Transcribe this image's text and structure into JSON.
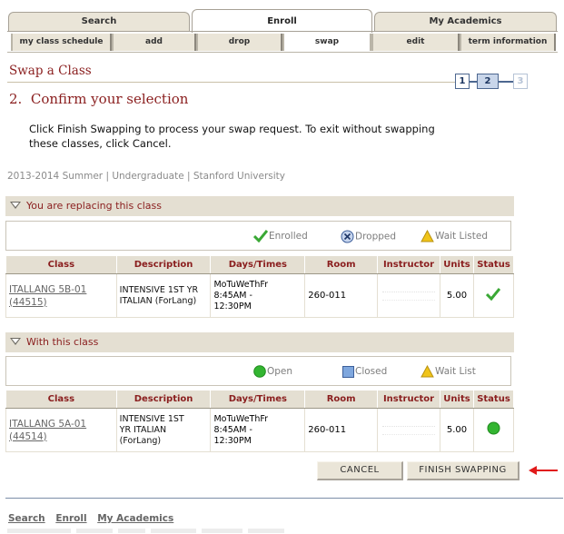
{
  "main_tabs": [
    {
      "label": "Search",
      "active": false
    },
    {
      "label": "Enroll",
      "active": true
    },
    {
      "label": "My Academics",
      "active": false
    }
  ],
  "sub_tabs": [
    {
      "label": "my class schedule",
      "active": false
    },
    {
      "label": "add",
      "active": false
    },
    {
      "label": "drop",
      "active": false
    },
    {
      "label": "swap",
      "active": true
    },
    {
      "label": "edit",
      "active": false
    },
    {
      "label": "term information",
      "active": false
    }
  ],
  "page": {
    "title": "Swap a Class",
    "step_title": "2.  Confirm your selection",
    "instructions": "Click Finish Swapping to process your swap request. To exit without swapping these classes, click Cancel.",
    "term_line": "2013-2014 Summer | Undergraduate | Stanford University"
  },
  "steps": {
    "items": [
      "1",
      "2",
      "3"
    ],
    "current": 2
  },
  "replacing": {
    "header": "You are replacing this class",
    "legend": [
      {
        "icon": "checkmark-icon",
        "label": "Enrolled"
      },
      {
        "icon": "dropped-x-icon",
        "label": "Dropped"
      },
      {
        "icon": "wait-listed-triangle-icon",
        "label": "Wait Listed"
      }
    ],
    "columns": [
      "Class",
      "Description",
      "Days/Times",
      "Room",
      "Instructor",
      "Units",
      "Status"
    ],
    "row": {
      "class_line1": "ITALLANG 5B-01",
      "class_line2": "(44515)",
      "description": "INTENSIVE 1ST YR ITALIAN (ForLang)",
      "days": "MoTuWeThFr",
      "time1": "8:45AM -",
      "time2": "12:30PM",
      "room": "260-011",
      "units": "5.00",
      "status_icon": "enrolled-checkmark-icon"
    }
  },
  "with_class": {
    "header": "With this class",
    "legend": [
      {
        "icon": "open-circle-icon",
        "label": "Open"
      },
      {
        "icon": "closed-square-icon",
        "label": "Closed"
      },
      {
        "icon": "wait-list-triangle-icon",
        "label": "Wait List"
      }
    ],
    "columns": [
      "Class",
      "Description",
      "Days/Times",
      "Room",
      "Instructor",
      "Units",
      "Status"
    ],
    "row": {
      "class_line1": "ITALLANG 5A-01",
      "class_line2": "(44514)",
      "desc1": "INTENSIVE 1ST",
      "desc2": "YR ITALIAN",
      "desc3": "(ForLang)",
      "days": "MoTuWeThFr",
      "time1": "8:45AM -",
      "time2": "12:30PM",
      "room": "260-011",
      "units": "5.00",
      "status_icon": "open-circle-icon"
    }
  },
  "buttons": {
    "cancel": "CANCEL",
    "finish": "FINISH SWAPPING"
  },
  "footer_links": [
    "Search",
    "Enroll",
    "My Academics"
  ],
  "colors": {
    "accent": "#8a1e1e",
    "tab_bg": "#e4dfd2",
    "open_green": "#33b531",
    "closed_blue": "#7fa7de",
    "wait_yellow": "#f0c419",
    "arrow_red": "#e11a1a"
  }
}
